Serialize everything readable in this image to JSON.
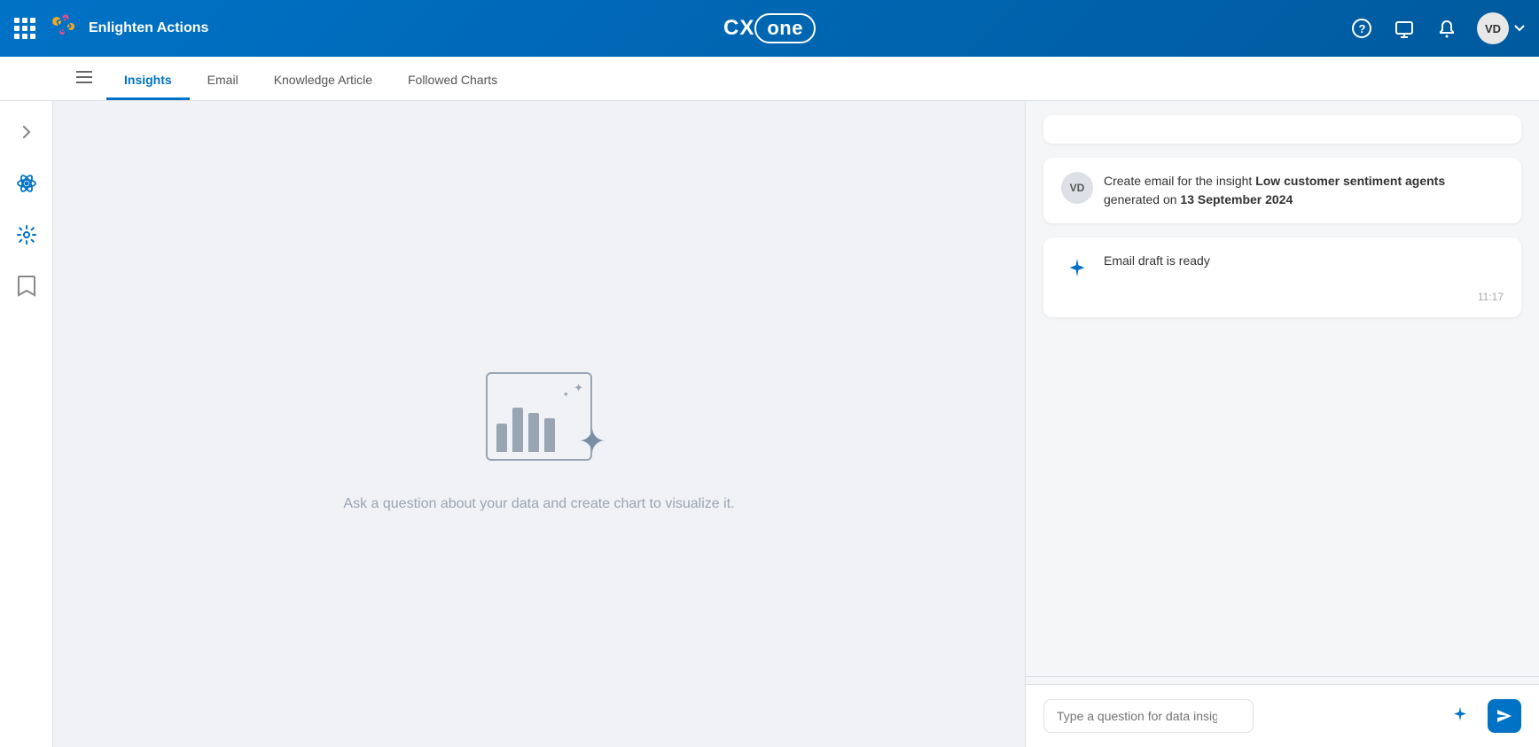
{
  "topbar": {
    "app_name": "Enlighten Actions",
    "logo_text": "CX",
    "logo_cloud": "one",
    "avatar_initials": "VD",
    "help_icon": "?",
    "screen_icon": "⬜",
    "bell_icon": "🔔"
  },
  "tabs": {
    "hamburger_label": "≡",
    "items": [
      {
        "id": "insights",
        "label": "Insights",
        "active": true
      },
      {
        "id": "email",
        "label": "Email",
        "active": false
      },
      {
        "id": "knowledge-article",
        "label": "Knowledge Article",
        "active": false
      },
      {
        "id": "followed-charts",
        "label": "Followed Charts",
        "active": false
      }
    ]
  },
  "sidebar": {
    "chevron_label": ">",
    "icons": [
      {
        "id": "atom",
        "symbol": "⚛"
      },
      {
        "id": "settings",
        "symbol": "⚙"
      },
      {
        "id": "bookmark",
        "symbol": "🔖"
      }
    ]
  },
  "empty_state": {
    "message": "Ask a question about your data and create chart to visualize it."
  },
  "chat": {
    "messages": [
      {
        "id": "msg1",
        "type": "user",
        "avatar": "VD",
        "text_prefix": "Create email for the insight ",
        "text_bold": "Low customer sentiment agents",
        "text_suffix": " generated on ",
        "text_date": "13 September 2024"
      },
      {
        "id": "msg2",
        "type": "ai",
        "text": "Email draft is ready",
        "timestamp": "11:17"
      }
    ]
  },
  "input": {
    "placeholder": "Type a question for data insights",
    "send_label": "➤"
  }
}
